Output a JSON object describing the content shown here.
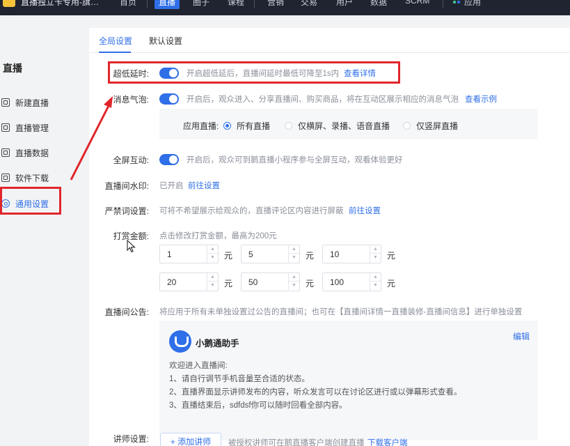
{
  "topbar": {
    "app_title": "直播独立卡专用-旗…",
    "nav": [
      "首页",
      "直播",
      "圈子",
      "课程",
      "营销",
      "交易",
      "用户",
      "数据",
      "SCRM",
      "应用"
    ],
    "active_nav": "直播"
  },
  "sidebar": {
    "title": "直播",
    "items": [
      {
        "label": "新建直播",
        "icon": "new-live-icon"
      },
      {
        "label": "直播管理",
        "icon": "live-manage-icon"
      },
      {
        "label": "直播数据",
        "icon": "live-data-icon"
      },
      {
        "label": "软件下载",
        "icon": "download-icon"
      },
      {
        "label": "通用设置",
        "icon": "settings-icon"
      }
    ],
    "active": "通用设置"
  },
  "tabs": [
    "全局设置",
    "默认设置"
  ],
  "settings": {
    "ultra_low_latency": {
      "label": "超低延时:",
      "hint": "开启超低延后，直播间延时最低可降至1s内",
      "link": "查看详情",
      "enabled": true
    },
    "message_bubble": {
      "label": "消息气泡:",
      "hint": "开启后，观众进入、分享直播间、购买商品，将在互动区展示相应的消息气泡",
      "link": "查看示例",
      "enabled": true
    },
    "apply_live": {
      "label": "应用直播:",
      "options": [
        "所有直播",
        "仅横屏、录播、语音直播",
        "仅竖屏直播"
      ],
      "selected": "所有直播"
    },
    "fullscreen": {
      "label": "全屏互动:",
      "hint": "开启后，观众可到鹅直播小程序参与全屏互动，观看体验更好",
      "enabled": true
    },
    "watermark": {
      "label": "直播间水印:",
      "hint": "已开启",
      "link": "前往设置"
    },
    "banned_words": {
      "label": "严禁词设置:",
      "hint": "可将不希望展示给观众的，直播评论区内容进行屏蔽",
      "link": "前往设置"
    },
    "reward": {
      "label": "打赏金额:",
      "hint": "点击修改打赏金额，最高为200元",
      "amounts": [
        "1",
        "5",
        "10",
        "20",
        "50",
        "100"
      ],
      "unit": "元"
    },
    "announcement": {
      "label": "直播间公告:",
      "hint": "将应用于所有未单独设置过公告的直播间；也可在【直播间详情一直播装修-直播间信息】进行单独设置",
      "name": "小鹅通助手",
      "edit": "编辑",
      "lines": [
        "欢迎进入直播间:",
        "1、请自行调节手机音量至合适的状态。",
        "2、直播界面显示讲师发布的内容，听众发言可以在讨论区进行或以弹幕形式查看。",
        "3、直播结束后，sdfdsf你可以随时回看全部内容。"
      ]
    },
    "lecturer": {
      "label": "讲师设置:",
      "button": "+ 添加讲师",
      "hint": "被授权讲师可在鹅直播客户端创建直播",
      "link": "下载客户端"
    }
  },
  "colors": {
    "accent": "#2f6fe8",
    "highlight": "#e0262b",
    "topbar": "#1f2430"
  }
}
